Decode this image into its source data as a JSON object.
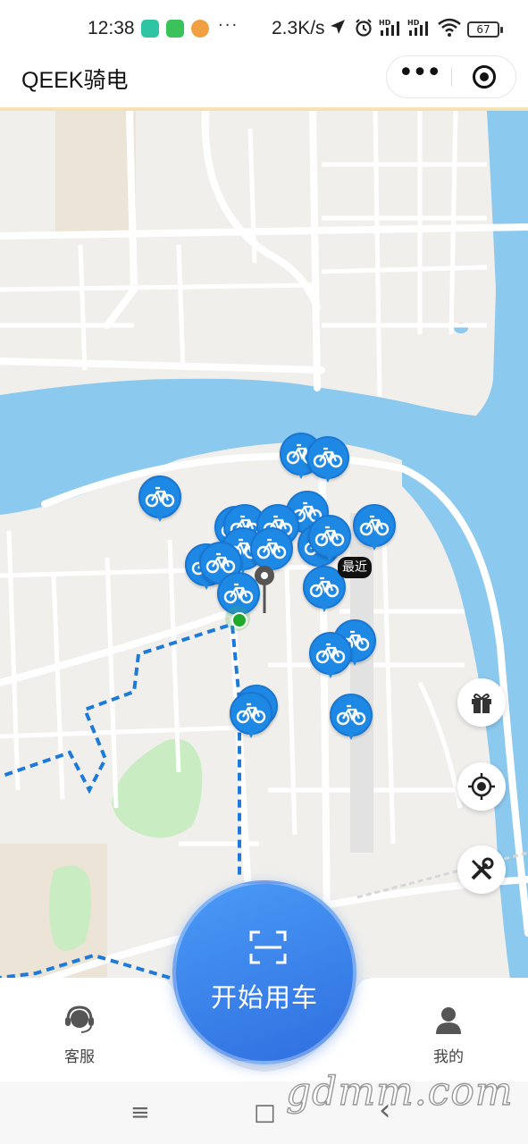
{
  "status_bar": {
    "time": "12:38",
    "app_icons": [
      "navigation-app-icon",
      "wechat-icon",
      "qq-icon"
    ],
    "more": "···",
    "net_speed": "2.3K/s",
    "icons": [
      "location-arrow-icon",
      "alarm-icon",
      "signal-hd-1-icon",
      "signal-hd-2-icon",
      "wifi-icon"
    ],
    "battery": "67"
  },
  "title_bar": {
    "title": "QEEK骑电",
    "more_icon": "•••",
    "close_icon": "target-close-icon"
  },
  "map": {
    "nearest_label": "最近",
    "bike_count": 22,
    "colors": {
      "water": "#8cc9ee",
      "land": "#f0efec",
      "road": "#ffffff",
      "park": "#c9ecc3",
      "pin": "#1e88e5",
      "route": "#1e7ad9"
    }
  },
  "side_buttons": [
    {
      "name": "gift-button",
      "icon": "gift-icon"
    },
    {
      "name": "locate-button",
      "icon": "crosshair-icon"
    },
    {
      "name": "repair-button",
      "icon": "wrench-screwdriver-icon"
    }
  ],
  "bottom_nav": {
    "service_label": "客服",
    "start_label": "开始用车",
    "profile_label": "我的"
  },
  "system_nav": {
    "menu": "≡",
    "home": "□",
    "back": "‹"
  },
  "watermark": "gdmm.com"
}
